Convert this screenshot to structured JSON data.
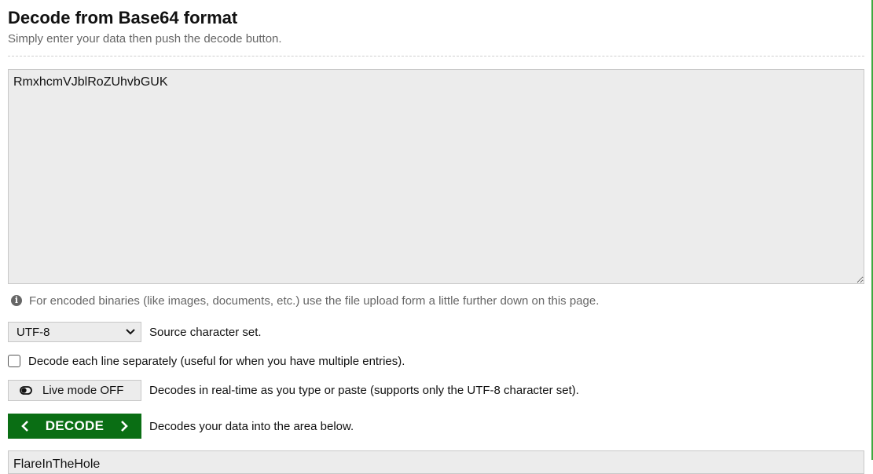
{
  "header": {
    "title": "Decode from Base64 format",
    "subtitle": "Simply enter your data then push the decode button."
  },
  "input": {
    "value": "RmxhcmVJblRoZUhvbGUK"
  },
  "info": {
    "icon": "info-icon",
    "text": "For encoded binaries (like images, documents, etc.) use the file upload form a little further down on this page."
  },
  "charset": {
    "selected": "UTF-8",
    "label": "Source character set."
  },
  "line_option": {
    "checked": false,
    "label": "Decode each line separately (useful for when you have multiple entries)."
  },
  "live_mode": {
    "button_label": "Live mode OFF",
    "description": "Decodes in real-time as you type or paste (supports only the UTF-8 character set)."
  },
  "decode": {
    "button_label": "DECODE",
    "description": "Decodes your data into the area below."
  },
  "output": {
    "value": "FlareInTheHole"
  },
  "colors": {
    "accent_green": "#0a6e14",
    "field_bg": "#ececec",
    "muted_text": "#666666",
    "right_border": "#3fa83f"
  }
}
